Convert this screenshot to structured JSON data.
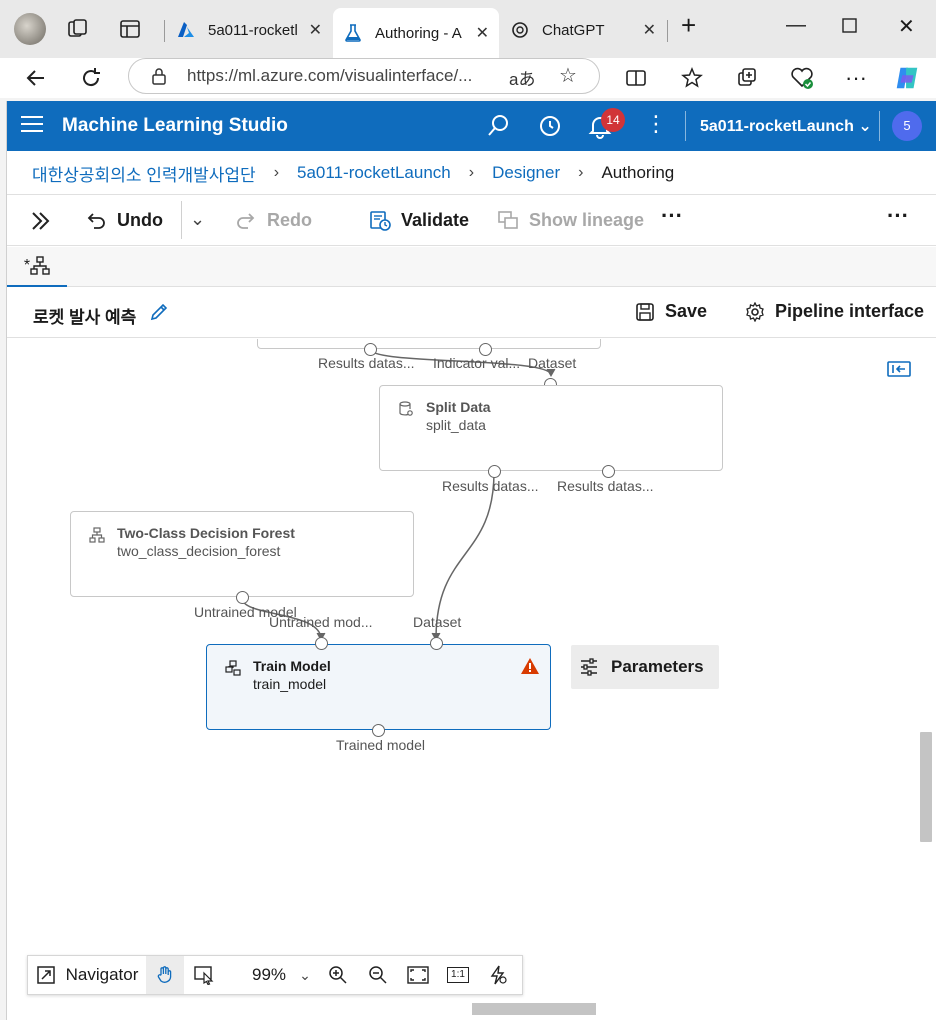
{
  "browser": {
    "tabs": [
      {
        "title": "5a011-rocketl",
        "active": false
      },
      {
        "title": "Authoring - A",
        "active": true
      },
      {
        "title": "ChatGPT",
        "active": false
      }
    ],
    "url": "https://ml.azure.com/visualinterface/...",
    "read_aloud_glyph": "aあ"
  },
  "app": {
    "title": "Machine Learning Studio",
    "notification_count": "14",
    "workspace": "5a011-rocketLaunch",
    "user_initial": "5"
  },
  "breadcrumb": {
    "items": [
      "대한상공회의소 인력개발사업단",
      "5a011-rocketLaunch",
      "Designer"
    ],
    "current": "Authoring"
  },
  "toolbar": {
    "undo": "Undo",
    "redo": "Redo",
    "validate": "Validate",
    "show_lineage": "Show lineage"
  },
  "doc_tab": {
    "label": "*"
  },
  "pipeline": {
    "name": "로켓 발사 예측",
    "save": "Save",
    "pipeline_interface": "Pipeline interface"
  },
  "canvas": {
    "top_node_ports": [
      "Results datas...",
      "Indicator val...",
      "Dataset"
    ],
    "split_data": {
      "title": "Split Data",
      "subtitle": "split_data",
      "outputs": [
        "Results datas...",
        "Results datas..."
      ]
    },
    "decision_forest": {
      "title": "Two-Class Decision Forest",
      "subtitle": "two_class_decision_forest",
      "output": "Untrained model"
    },
    "train_model": {
      "title": "Train Model",
      "subtitle": "train_model",
      "inputs": [
        "Untrained mod...",
        "Dataset"
      ],
      "output": "Trained model"
    },
    "parameters_label": "Parameters"
  },
  "navigator": {
    "label": "Navigator",
    "zoom": "99%",
    "one_to_one": "1:1"
  }
}
